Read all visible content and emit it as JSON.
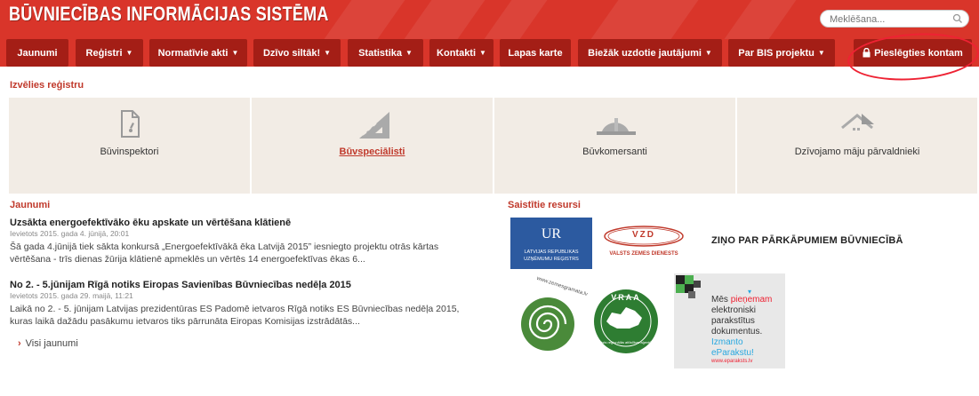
{
  "header": {
    "title": "BŪVNIECĪBAS INFORMĀCIJAS SISTĒMA",
    "search_placeholder": "Meklēšana..."
  },
  "nav": [
    {
      "label": "Jaunumi"
    },
    {
      "label": "Reģistri",
      "dropdown": true
    },
    {
      "label": "Normatīvie akti",
      "dropdown": true
    },
    {
      "label": "Dzīvo siltāk!",
      "dropdown": true
    },
    {
      "label": "Statistika",
      "dropdown": true
    },
    {
      "label": "Kontakti",
      "dropdown": true
    },
    {
      "label": "Lapas karte"
    },
    {
      "label": "Biežāk uzdotie jautājumi",
      "dropdown": true
    },
    {
      "label": "Par BIS projektu",
      "dropdown": true
    },
    {
      "label": "Pieslēgties kontam",
      "icon": "lock-icon"
    }
  ],
  "registry": {
    "title": "Izvēlies reģistru",
    "tiles": [
      {
        "label": "Būvinspektori",
        "icon": "document-pen-icon"
      },
      {
        "label": "Būvspeciālisti",
        "icon": "set-square-icon",
        "active": true
      },
      {
        "label": "Būvkomersanti",
        "icon": "hard-hat-icon"
      },
      {
        "label": "Dzīvojamo māju pārvaldnieki",
        "icon": "house-icon"
      }
    ]
  },
  "news": {
    "title": "Jaunumi",
    "items": [
      {
        "title": "Uzsākta energoefektīvāko ēku apskate un vērtēšana klātienē",
        "meta": "Ievietots 2015. gada 4. jūnijā, 20:01",
        "body1": "Šā gada 4.jūnijā tiek sākta konkursā „Energoefektīvākā ēka Latvijā 2015” iesniegto projektu otrās kārtas",
        "body2": "vērtēšana - trīs dienas žūrija klātienē apmeklēs un vērtēs 14 energoefektīvas ēkas 6..."
      },
      {
        "title": "No 2. - 5.jūnijam Rīgā notiks Eiropas Savienības Būvniecības nedēļa 2015",
        "meta": "Ievietots 2015. gada 29. maijā, 11:21",
        "body1": "Laikā no 2. - 5. jūnijam Latvijas prezidentūras ES Padomē ietvaros Rīgā notiks ES Būvniecības nedēļa 2015,",
        "body2": "kuras laikā dažādu pasākumu ietvaros tiks pārrunāta Eiropas Komisijas izstrādātās..."
      }
    ],
    "all_link": "Visi jaunumi"
  },
  "resources": {
    "title": "Saistītie resursi",
    "ur": {
      "abbr": "UR",
      "line1": "LATVIJAS REPUBLIKAS",
      "line2": "UZŅĒMUMU REĢISTRS"
    },
    "vzd": {
      "abbr": "VZD",
      "name": "VALSTS ZEMES DIENESTS"
    },
    "report": "ZIŅO PAR PĀRKĀPUMIEM BŪVNIECĪBĀ",
    "zemesgramata": "www.zemesgramata.lv",
    "vraa": "VRAA",
    "vraa_sub": "Valsts reģionālās attīstības aģentūra",
    "eparaksts": {
      "line1": "Mēs",
      "line1b": "pieņemam",
      "line2": "elektroniski",
      "line3": "parakstītus",
      "line4": "dokumentus.",
      "line5": "Izmanto",
      "line6": "eParakstu!",
      "url": "www.eparaksts.lv"
    }
  },
  "colors": {
    "brand_red": "#d9352a",
    "nav_dark": "#a41e16",
    "accent_text": "#c0392b",
    "tile_bg": "#f2ece5"
  }
}
